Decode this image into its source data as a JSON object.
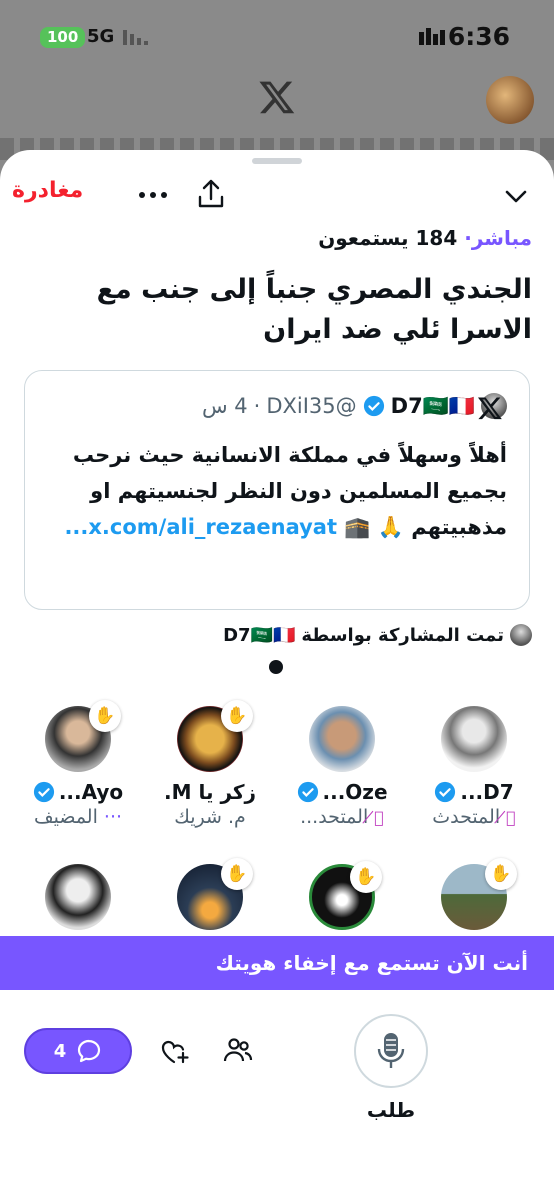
{
  "status_bar": {
    "battery": "100",
    "network": "5G",
    "time": "6:36"
  },
  "space": {
    "leave_label": "مغادرة",
    "live_label": "مباشر",
    "listeners_count": "184",
    "listeners_label": "يستمعون",
    "title": "الجندي المصري جنباً إلى جنب مع الاسرا ئلي ضد ايران"
  },
  "pinned_tweet": {
    "display_name": "D7🇸🇦🇫🇷",
    "handle": "@DXiI35",
    "time": "4 س",
    "body": "أهلاً وسهلاً في مملكة الانسانية حيث نرحب بجميع المسلمين دون النظر لجنسيتهم او مذهبيتهم 🙏 🕋",
    "link": "x.com/ali_rezaenayat..."
  },
  "shared_by": {
    "label": "تمت المشاركة بواسطة",
    "name": "D7🇸🇦🇫🇷"
  },
  "speakers": [
    {
      "name": "D7...",
      "role": "المتحدث",
      "verified": true,
      "muted": true
    },
    {
      "name": "Oze...",
      "role": "المتحد...",
      "verified": true,
      "muted": true
    },
    {
      "name": "زكر يا M.",
      "role": "م. شريك",
      "verified": false,
      "muted": false
    },
    {
      "name": "Ayo...",
      "role": "المضيف",
      "verified": true,
      "muted": false
    }
  ],
  "banner_text": "أنت الآن تستمع مع إخفاء هويتك",
  "controls": {
    "comments_count": "4",
    "request_label": "طلب"
  },
  "colors": {
    "accent": "#7856ff",
    "leave": "#f4212e",
    "verified": "#1d9bf0",
    "link": "#1d9bf0"
  }
}
